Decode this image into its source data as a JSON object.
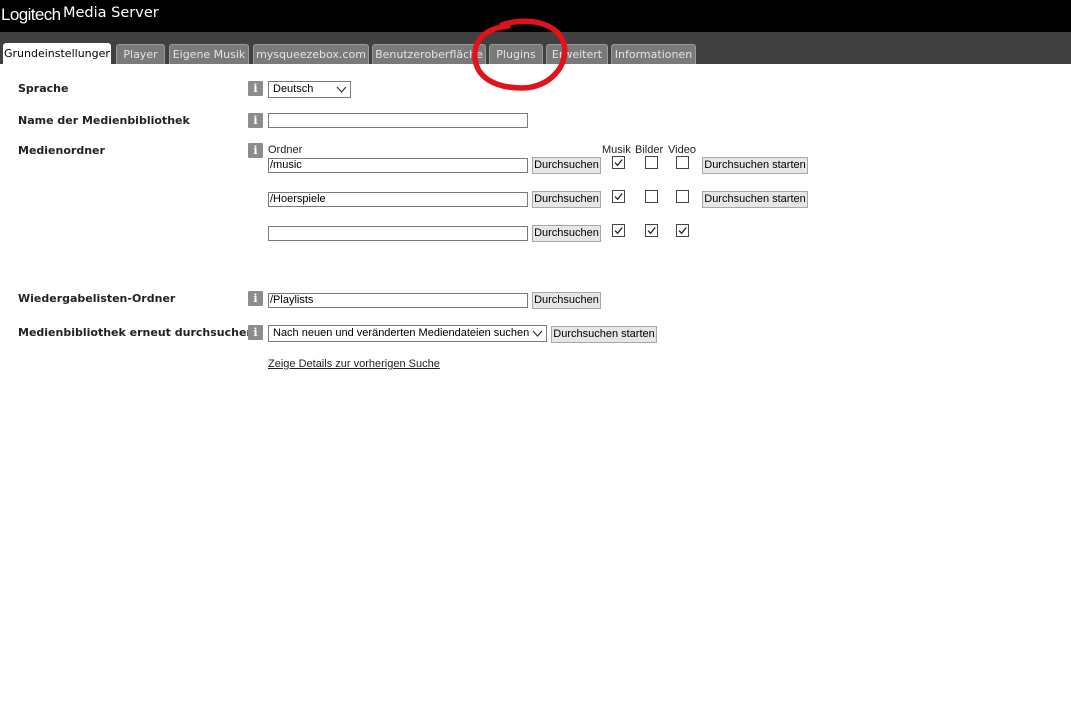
{
  "app": {
    "logo_text": "Logitech",
    "title": "Media Server"
  },
  "tabs": [
    {
      "label": "Grundeinstellungen",
      "active": true
    },
    {
      "label": "Player",
      "active": false
    },
    {
      "label": "Eigene Musik",
      "active": false
    },
    {
      "label": "mysqueezebox.com",
      "active": false
    },
    {
      "label": "Benutzeroberfläche",
      "active": false
    },
    {
      "label": "Plugins",
      "active": false
    },
    {
      "label": "Erweitert",
      "active": false
    },
    {
      "label": "Informationen",
      "active": false
    }
  ],
  "settings": {
    "language": {
      "label": "Sprache",
      "value": "Deutsch"
    },
    "library_name": {
      "label": "Name der Medienbibliothek",
      "value": ""
    },
    "media_folders": {
      "label": "Medienordner",
      "headers": {
        "folder": "Ordner",
        "music": "Musik",
        "images": "Bilder",
        "video": "Video"
      },
      "browse_label": "Durchsuchen",
      "scan_label": "Durchsuchen starten",
      "rows": [
        {
          "path": "/music",
          "music": true,
          "images": false,
          "video": false
        },
        {
          "path": "/Hoerspiele",
          "music": true,
          "images": false,
          "video": false
        },
        {
          "path": "",
          "music": true,
          "images": true,
          "video": true
        }
      ]
    },
    "playlist_folder": {
      "label": "Wiedergabelisten-Ordner",
      "value": "/Playlists",
      "browse_label": "Durchsuchen"
    },
    "rescan": {
      "label": "Medienbibliothek erneut durchsuchen",
      "selected": "Nach neuen und veränderten Mediendateien suchen",
      "button": "Durchsuchen starten"
    },
    "details_link": "Zeige Details zur vorherigen Suche"
  },
  "info_icon_glyph": "i",
  "colors": {
    "annotation": "#e0121c",
    "titlebar": "#000000",
    "tabbar": "#404040"
  }
}
